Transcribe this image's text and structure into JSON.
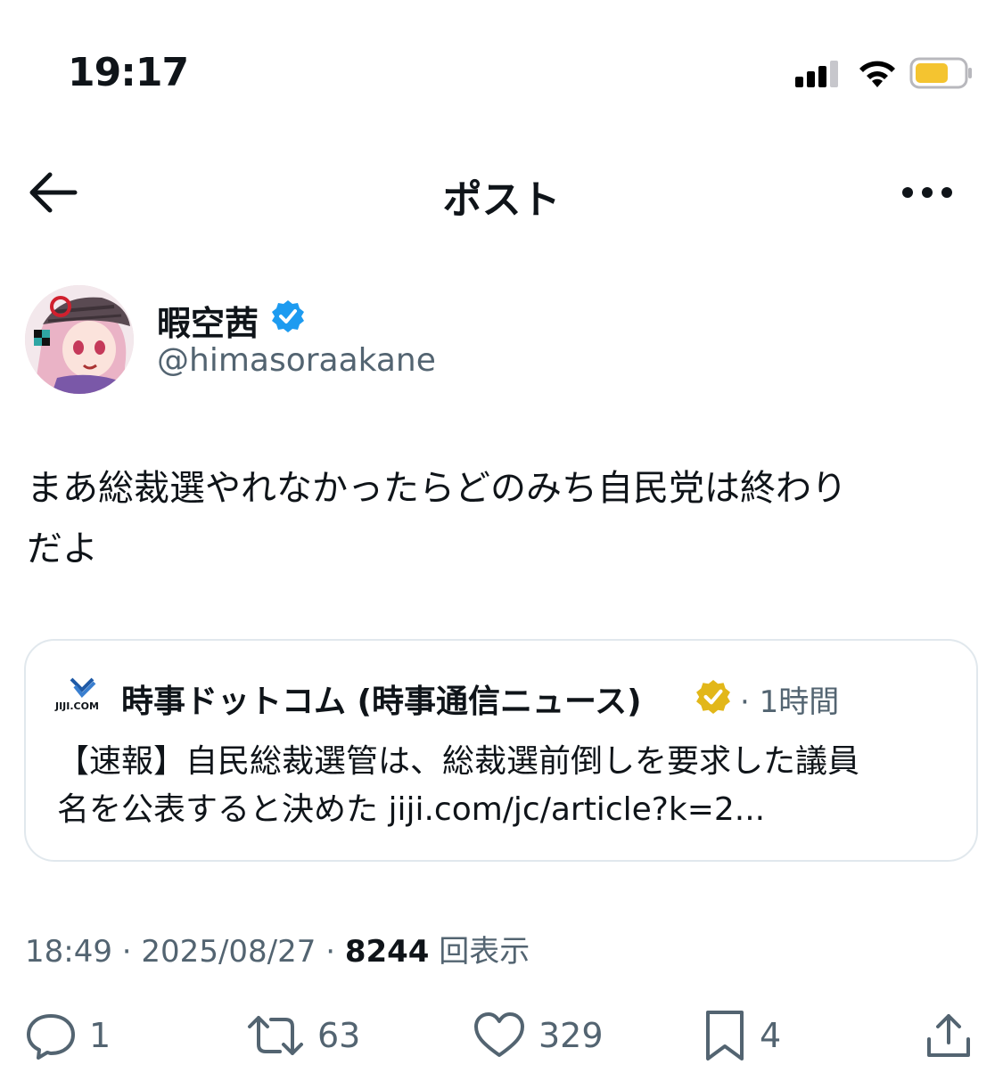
{
  "status_bar": {
    "time": "19:17"
  },
  "header": {
    "title": "ポスト"
  },
  "author": {
    "name": "暇空茜",
    "handle": "@himasoraakane"
  },
  "post": {
    "text_line1": "まあ総裁選やれなかったらどのみち自民党は終わり",
    "text_line2": "だよ"
  },
  "quote": {
    "logo_text": "JIJI.COM",
    "name": "時事ドットコム (時事通信ニュース)",
    "time": "· 1時間",
    "text_line1": "【速報】自民総裁選管は、総裁選前倒しを要求した議員",
    "text_line2": "名を公表すると決めた jiji.com/jc/article?k=2..."
  },
  "meta": {
    "time": "18:49",
    "date": "2025/08/27",
    "views_count": "8244",
    "views_label": "回表示"
  },
  "actions": {
    "reply_count": "1",
    "retweet_count": "63",
    "like_count": "329",
    "bookmark_count": "4"
  },
  "colors": {
    "verified_blue": "#1d9bf0",
    "verified_gold": "#e2b719",
    "secondary_text": "#536471",
    "battery_fill": "#f4c430"
  },
  "icons": [
    "back-arrow-icon",
    "more-icon",
    "verified-icon",
    "gold-verified-icon",
    "reply-icon",
    "retweet-icon",
    "like-icon",
    "bookmark-icon",
    "share-icon",
    "signal-icon",
    "wifi-icon",
    "battery-icon"
  ]
}
